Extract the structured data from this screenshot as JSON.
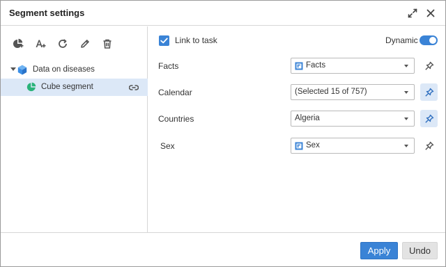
{
  "dialog": {
    "title": "Segment settings"
  },
  "toolbar": {
    "buttons": [
      "add-segment-icon",
      "add-attribute-icon",
      "refresh-icon",
      "edit-icon",
      "delete-icon"
    ]
  },
  "tree": {
    "root": {
      "label": "Data on diseases",
      "icon": "cube-icon",
      "expanded": true
    },
    "child": {
      "label": "Cube segment",
      "icon": "segment-icon",
      "selected": true
    }
  },
  "settings": {
    "link_to_task": {
      "label": "Link to task",
      "checked": true
    },
    "dynamic": {
      "label": "Dynamic",
      "on": true
    }
  },
  "dimensions": [
    {
      "label": "Facts",
      "value": "Facts",
      "has_icon": true,
      "pinned": false
    },
    {
      "label": "Calendar",
      "value": "(Selected 15 of 757)",
      "has_icon": false,
      "pinned": true
    },
    {
      "label": "Countries",
      "value": "Algeria",
      "has_icon": false,
      "pinned": true
    },
    {
      "label": "Sex",
      "value": "Sex",
      "has_icon": true,
      "pinned": false
    }
  ],
  "footer": {
    "apply_label": "Apply",
    "undo_label": "Undo"
  },
  "colors": {
    "accent": "#3a83d6",
    "selected_bg": "#dce8f7",
    "cube": "#3a8ee6",
    "segment": "#2bb37a"
  }
}
